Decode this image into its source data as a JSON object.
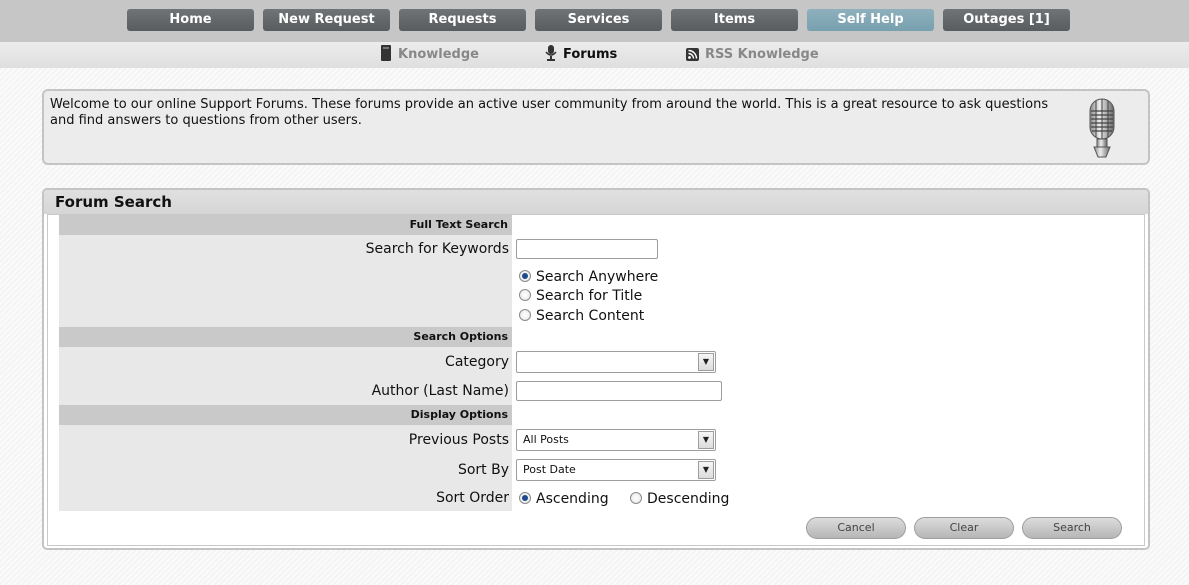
{
  "nav": {
    "items": [
      {
        "label": "Home"
      },
      {
        "label": "New Request"
      },
      {
        "label": "Requests"
      },
      {
        "label": "Services"
      },
      {
        "label": "Items"
      },
      {
        "label": "Self Help"
      },
      {
        "label": "Outages [1]"
      }
    ],
    "active": "Self Help",
    "colors": {
      "button": "#64686a",
      "active": "#82a8b6",
      "bar": "#c6c6c6"
    }
  },
  "subnav": {
    "items": [
      {
        "label": "Knowledge",
        "icon": "book-icon"
      },
      {
        "label": "Forums",
        "icon": "microphone-icon"
      },
      {
        "label": "RSS Knowledge",
        "icon": "rss-icon"
      }
    ],
    "active": "Forums"
  },
  "welcome": {
    "text": "Welcome to our online Support Forums. These forums provide an active user community from around the world. This is a great resource to ask questions and find answers to questions from other users.",
    "icon": "microphone-icon"
  },
  "search": {
    "title": "Forum Search",
    "sections": {
      "full_text": "Full Text Search",
      "options": "Search Options",
      "display": "Display Options"
    },
    "keywords_label": "Search for Keywords",
    "keywords_value": "",
    "scope_options": [
      "Search Anywhere",
      "Search for Title",
      "Search Content"
    ],
    "scope_selected": "Search Anywhere",
    "category_label": "Category",
    "category_value": "",
    "author_label": "Author (Last Name)",
    "author_value": "",
    "previous_posts_label": "Previous Posts",
    "previous_posts_value": "All Posts",
    "sort_by_label": "Sort By",
    "sort_by_value": "Post Date",
    "sort_order_label": "Sort Order",
    "sort_order_options": [
      "Ascending",
      "Descending"
    ],
    "sort_order_selected": "Ascending",
    "buttons": {
      "cancel": "Cancel",
      "clear": "Clear",
      "search": "Search"
    }
  }
}
